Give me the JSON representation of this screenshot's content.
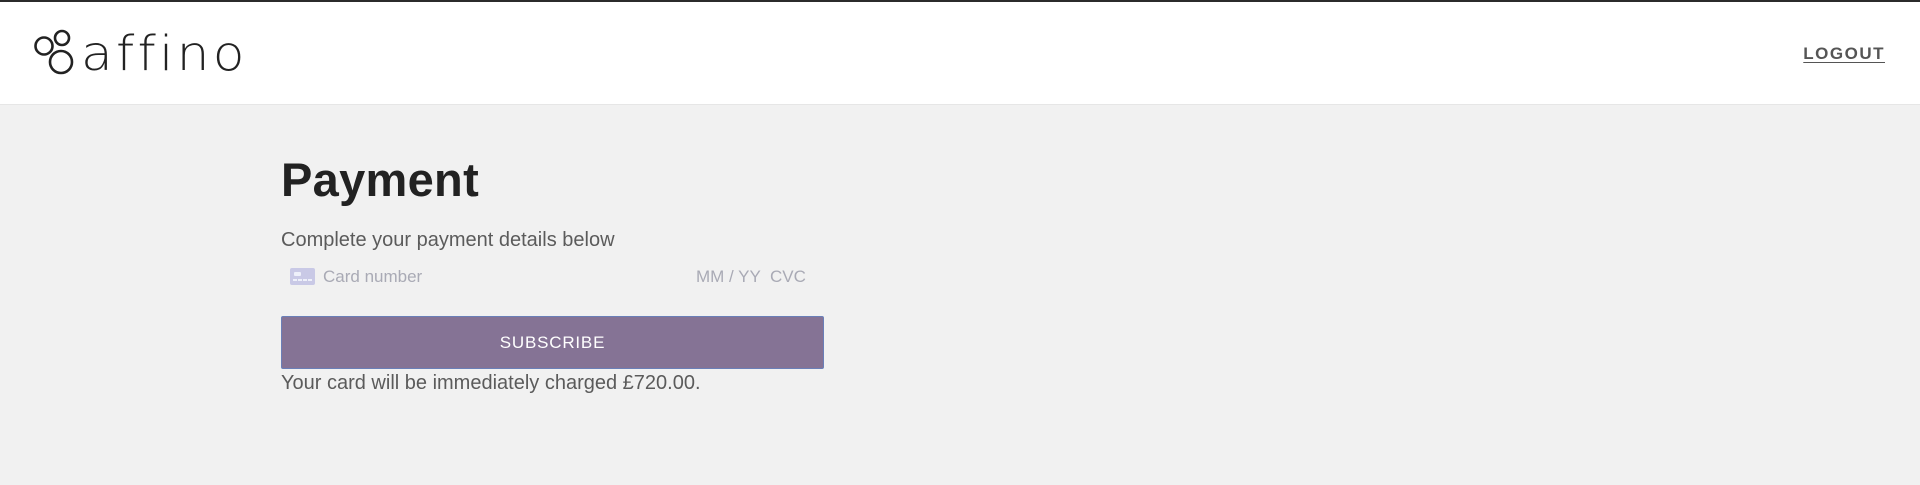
{
  "header": {
    "brand_name": "affino",
    "logout_label": "LOGOUT"
  },
  "payment": {
    "title": "Payment",
    "subtitle": "Complete your payment details below",
    "card_number_placeholder": "Card number",
    "expiry_placeholder": "MM / YY",
    "cvc_placeholder": "CVC",
    "subscribe_label": "SUBSCRIBE",
    "charge_note": "Your card will be immediately charged £720.00."
  },
  "icons": {
    "logo": "affino-logo-icon",
    "card": "credit-card-icon"
  },
  "colors": {
    "background": "#f1f1f1",
    "header": "#ffffff",
    "button": "#857395",
    "title": "#222222",
    "text": "#5b5b5b",
    "placeholder": "#a9aab5"
  }
}
